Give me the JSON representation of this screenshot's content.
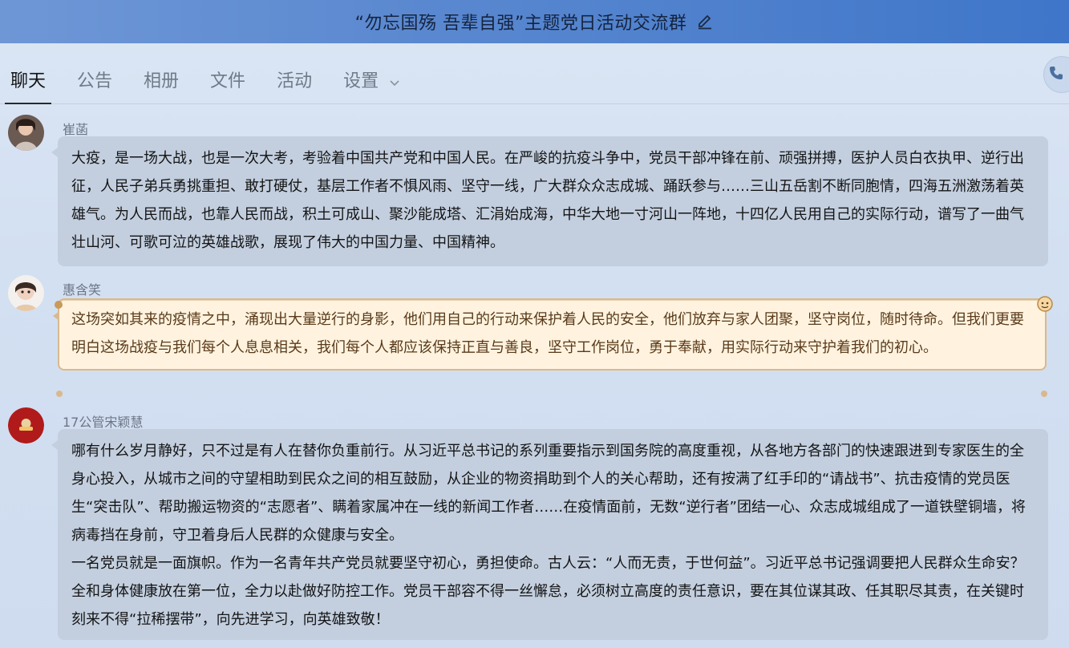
{
  "window": {
    "title": "“勿忘国殇 吾辈自强”主题党日活动交流群"
  },
  "tabs": [
    {
      "label": "聊天",
      "active": true
    },
    {
      "label": "公告"
    },
    {
      "label": "相册"
    },
    {
      "label": "文件"
    },
    {
      "label": "活动"
    },
    {
      "label": "设置"
    }
  ],
  "icons": {
    "edit": "pencil-icon",
    "dropdown": "chevron-down-icon",
    "call": "phone-icon"
  },
  "colors": {
    "titlebar": "#5a88d0",
    "bubble": "#c3cfdf",
    "special_bubble": "#fff3df",
    "special_border": "#d9b98c"
  },
  "messages": [
    {
      "sender": "崔菡",
      "paragraphs": [
        "大疫，是一场大战，也是一次大考，考验着中国共产党和中国人民。在严峻的抗疫斗争中，党员干部冲锋在前、顽强拼搏，医护人员白衣执甲、逆行出征，人民子弟兵勇挑重担、敢打硬仗，基层工作者不惧风雨、坚守一线，广大群众众志成城、踊跃参与……三山五岳割不断同胞情，四海五洲激荡着英雄气。为人民而战，也靠人民而战，积土可成山、聚沙能成塔、汇涓始成海，中华大地一寸河山一阵地，十四亿人民用自己的实际行动，谱写了一曲气壮山河、可歌可泣的英雄战歌，展现了伟大的中国力量、中国精神。"
      ]
    },
    {
      "sender": "惠含笑",
      "paragraphs": [
        "这场突如其来的疫情之中，涌现出大量逆行的身影，他们用自己的行动来保护着人民的安全，他们放弃与家人团聚，坚守岗位，随时待命。但我们更要明白这场战疫与我们每个人息息相关，我们每个人都应该保持正直与善良，坚守工作岗位，勇于奉献，用实际行动来守护着我们的初心。"
      ]
    },
    {
      "sender": "17公管宋颖慧",
      "paragraphs": [
        "哪有什么岁月静好，只不过是有人在替你负重前行。从习近平总书记的系列重要指示到国务院的高度重视，从各地方各部门的快速跟进到专家医生的全身心投入，从城市之间的守望相助到民众之间的相互鼓励，从企业的物资捐助到个人的关心帮助，还有按满了红手印的“请战书”、抗击疫情的党员医生“突击队”、帮助搬运物资的“志愿者”、瞒着家属冲在一线的新闻工作者……在疫情面前，无数“逆行者”团结一心、众志成城组成了一道铁壁铜墙，将病毒挡在身前，守卫着身后人民群的众健康与安全。",
        "一名党员就是一面旗帜。作为一名青年共产党员就要坚守初心，勇担使命。古人云：“人而无责，于世何益”。习近平总书记强调要把人民群众生命安？全和身体健康放在第一位，全力以赴做好防控工作。党员干部容不得一丝懈怠，必须树立高度的责任意识，要在其位谋其政、任其职尽其责，在关键时刻来不得“拉稀摆带”，向先进学习，向英雄致敬！"
      ]
    }
  ]
}
